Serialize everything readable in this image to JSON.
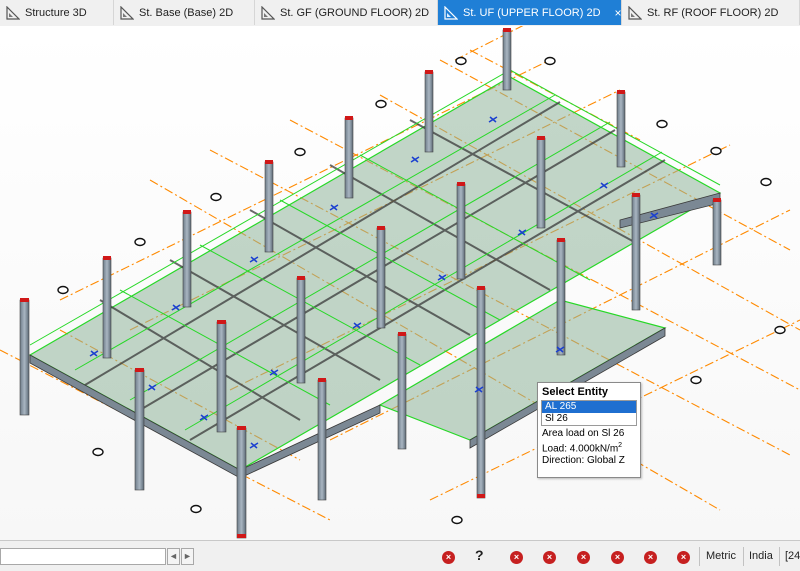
{
  "tabs": [
    {
      "label": "Structure 3D",
      "icon": "structure-3d-icon",
      "active": false
    },
    {
      "label": "St. Base (Base) 2D",
      "icon": "plan-2d-icon",
      "active": false
    },
    {
      "label": "St. GF (GROUND FLOOR) 2D",
      "icon": "plan-2d-icon",
      "active": false
    },
    {
      "label": "St. UF (UPPER FLOOR) 2D",
      "icon": "plan-2d-icon",
      "active": true
    },
    {
      "label": "St. RF (ROOF FLOOR) 2D",
      "icon": "plan-2d-icon",
      "active": false
    }
  ],
  "close_glyph": "×",
  "popup": {
    "title": "Select Entity",
    "items": [
      "AL 265",
      "Sl 26"
    ],
    "selected_index": 0,
    "info": {
      "line1": "Area load on Sl 26",
      "load_prefix": "Load: 4.000kN/m",
      "load_superscript": "2",
      "line3": "Direction: Global Z"
    }
  },
  "statusbar": {
    "command_value": "",
    "nav_prev": "◄",
    "nav_next": "►",
    "help_glyph": "?",
    "error_glyph": "×",
    "units": "Metric",
    "code": "India",
    "extra": "[24"
  },
  "colors": {
    "tab_active": "#1f7fd6",
    "column": "#8a9aa8",
    "column_cap": "#d01818",
    "beam_edge": "#28d828",
    "slab_fill": "#8fb49a",
    "grid_line": "#ff8800",
    "error_icon": "#c62020"
  }
}
